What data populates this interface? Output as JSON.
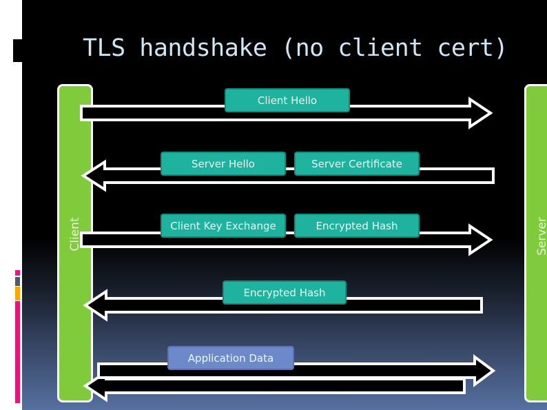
{
  "slide": {
    "title": "TLS handshake (no client cert)",
    "client_label": "Client",
    "server_label": "Server"
  },
  "messages": [
    {
      "label": "Client Hello",
      "direction": "client-to-server"
    },
    {
      "label": "Server Hello",
      "direction": "server-to-client"
    },
    {
      "label": "Server Certificate",
      "direction": "server-to-client"
    },
    {
      "label": "Client Key Exchange",
      "direction": "client-to-server"
    },
    {
      "label": "Encrypted Hash",
      "direction": "client-to-server"
    },
    {
      "label": "Encrypted Hash",
      "direction": "server-to-client"
    },
    {
      "label": "Application Data",
      "direction": "bidirectional"
    }
  ],
  "colors": {
    "participant_bar": "#7fcb3c",
    "message_box": "#1fb29e",
    "application_box": "#6e89c9",
    "title_text": "#cfe6f5"
  }
}
